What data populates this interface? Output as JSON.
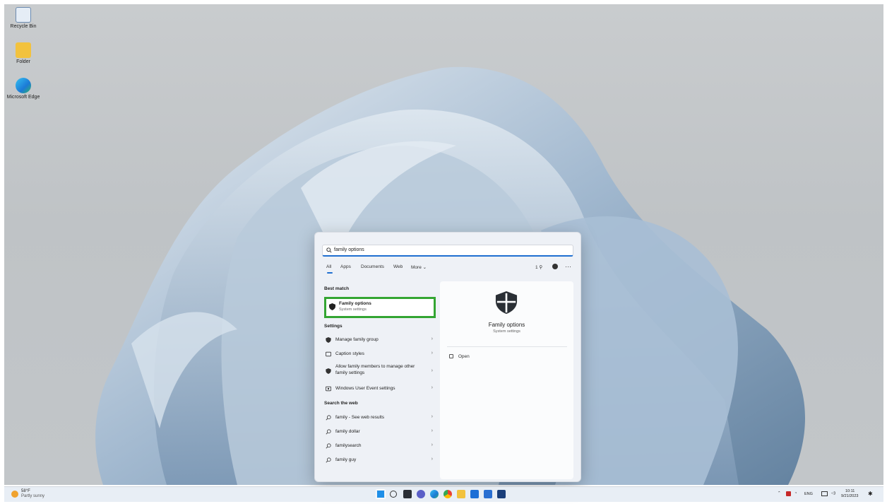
{
  "desktop": {
    "icons": [
      {
        "label": "Recycle Bin",
        "icon": "recycle-bin-icon"
      },
      {
        "label": "Folder",
        "icon": "folder-icon"
      },
      {
        "label": "Microsoft Edge",
        "icon": "edge-icon"
      }
    ]
  },
  "search": {
    "query": "family options",
    "filters": [
      "All",
      "Apps",
      "Documents",
      "Web",
      "More ⌄"
    ],
    "points": "1 ⚲"
  },
  "results": {
    "best_match_header": "Best match",
    "best_match": {
      "title": "Family options",
      "subtitle": "System settings"
    },
    "settings_header": "Settings",
    "settings": [
      {
        "label": "Manage family group",
        "chevron": "›"
      },
      {
        "label": "Caption styles",
        "chevron": "›"
      },
      {
        "label": "Allow family members to manage other family settings",
        "chevron": "›"
      },
      {
        "label": "Windows User Event settings",
        "chevron": "›"
      }
    ],
    "web_header": "Search the web",
    "web": [
      {
        "label": "family - See web results",
        "chevron": "›"
      },
      {
        "label": "family dollar",
        "chevron": "›"
      },
      {
        "label": "familysearch",
        "chevron": "›"
      },
      {
        "label": "family guy",
        "chevron": "›"
      }
    ]
  },
  "detail": {
    "title": "Family options",
    "subtitle": "System settings",
    "open_label": "Open"
  },
  "taskbar": {
    "weather_temp": "58°F",
    "weather_desc": "Partly sunny",
    "lang": "ENG",
    "time": "10:11",
    "date": "9/21/2023"
  },
  "colors": {
    "highlight_border": "#33a532",
    "accent": "#1f6fd0"
  }
}
